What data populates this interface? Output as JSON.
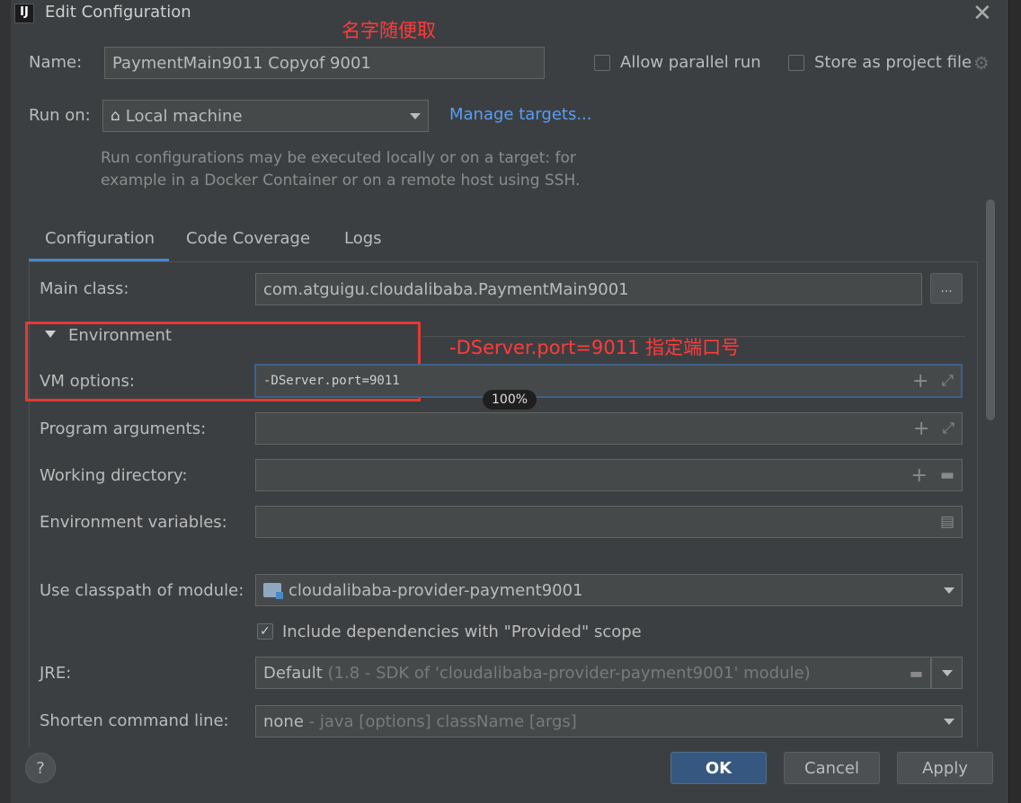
{
  "window": {
    "title": "Edit Configuration",
    "app_icon_text": "IJ"
  },
  "annotations": {
    "name_note": "名字随便取",
    "vm_note": "-DServer.port=9011 指定端口号"
  },
  "header": {
    "name_label": "Name:",
    "name_value": "PaymentMain9011 Copyof 9001",
    "allow_parallel_label": "Allow parallel run",
    "store_project_label": "Store as project file",
    "run_on_label": "Run on:",
    "run_on_value": "Local machine",
    "manage_targets": "Manage targets...",
    "hint_line1": "Run configurations may be executed locally or on a target: for",
    "hint_line2": "example in a Docker Container or on a remote host using SSH."
  },
  "tabs": [
    "Configuration",
    "Code Coverage",
    "Logs"
  ],
  "config": {
    "main_class_label": "Main class:",
    "main_class_value": "com.atguigu.cloudalibaba.PaymentMain9001",
    "browse_label": "...",
    "environment_label": "Environment",
    "vm_options_label": "VM options:",
    "vm_options_value": "-DServer.port=9011",
    "program_args_label": "Program arguments:",
    "working_dir_label": "Working directory:",
    "env_vars_label": "Environment variables:",
    "classpath_label": "Use classpath of module:",
    "classpath_value": "cloudalibaba-provider-payment9001",
    "include_deps_label": "Include dependencies with \"Provided\" scope",
    "jre_label": "JRE:",
    "jre_value": "Default",
    "jre_detail": "(1.8 - SDK of 'cloudalibaba-provider-payment9001' module)",
    "shorten_label": "Shorten command line:",
    "shorten_value": "none",
    "shorten_detail": "- java [options] className [args]"
  },
  "zoom": "100%",
  "footer": {
    "help": "?",
    "ok": "OK",
    "cancel": "Cancel",
    "apply": "Apply"
  },
  "checkbox_state": {
    "allow_parallel": false,
    "store_project": false,
    "include_deps": true
  },
  "colors": {
    "accent": "#4a88c7",
    "link": "#589df6",
    "annotation_red": "#e53935",
    "primary_button": "#365880"
  }
}
